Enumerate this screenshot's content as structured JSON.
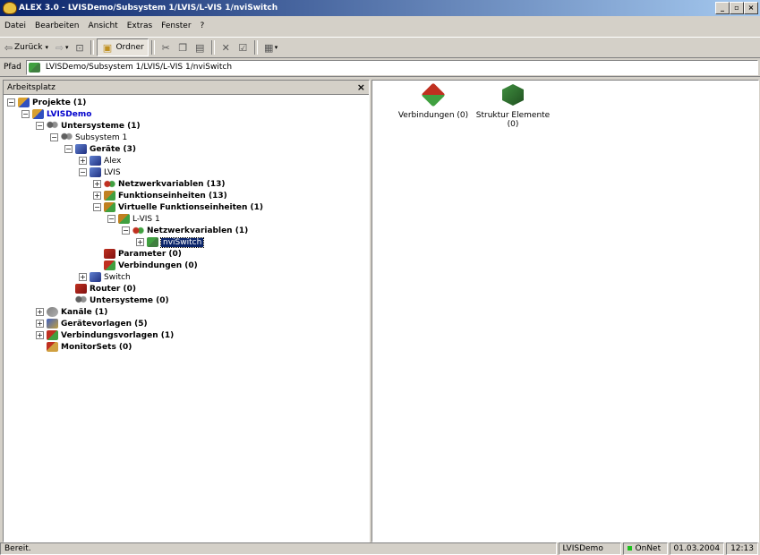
{
  "window": {
    "title": "ALEX 3.0 - LVISDemo/Subsystem 1/LVIS/L-VIS 1/nviSwitch"
  },
  "menu": [
    {
      "label": "Datei"
    },
    {
      "label": "Bearbeiten"
    },
    {
      "label": "Ansicht"
    },
    {
      "label": "Extras"
    },
    {
      "label": "Fenster"
    },
    {
      "label": "?"
    }
  ],
  "toolbar": {
    "back_label": "Zurück",
    "folder_label": "Ordner"
  },
  "address": {
    "label": "Pfad",
    "value": "LVISDemo/Subsystem 1/LVIS/L-VIS 1/nviSwitch"
  },
  "left_panel": {
    "title": "Arbeitsplatz",
    "close": "×"
  },
  "tree": [
    {
      "label": "Projekte (1)",
      "level": 0,
      "exp": "-",
      "icon": "cube",
      "bold": true
    },
    {
      "label": "LVISDemo",
      "level": 1,
      "exp": "-",
      "icon": "cube",
      "bold": true,
      "blue": true
    },
    {
      "label": "Untersysteme (1)",
      "level": 2,
      "exp": "-",
      "icon": "people",
      "bold": true
    },
    {
      "label": "Subsystem 1",
      "level": 3,
      "exp": "-",
      "icon": "people"
    },
    {
      "label": "Geräte (3)",
      "level": 4,
      "exp": "-",
      "icon": "dev",
      "bold": true
    },
    {
      "label": "Alex",
      "level": 5,
      "exp": "+",
      "icon": "dev"
    },
    {
      "label": "LVIS",
      "level": 5,
      "exp": "-",
      "icon": "dev"
    },
    {
      "label": "Netzwerkvariablen (13)",
      "level": 6,
      "exp": "+",
      "icon": "nv",
      "bold": true
    },
    {
      "label": "Funktionseinheiten (13)",
      "level": 6,
      "exp": "+",
      "icon": "func",
      "bold": true
    },
    {
      "label": "Virtuelle Funktionseinheiten (1)",
      "level": 6,
      "exp": "-",
      "icon": "func",
      "bold": true
    },
    {
      "label": "L-VIS 1",
      "level": 7,
      "exp": "-",
      "icon": "func"
    },
    {
      "label": "Netzwerkvariablen (1)",
      "level": 8,
      "exp": "-",
      "icon": "nv",
      "bold": true
    },
    {
      "label": "nviSwitch",
      "level": 9,
      "exp": "+",
      "icon": "nvi",
      "selected": true
    },
    {
      "label": "Parameter (0)",
      "level": 6,
      "exp": "",
      "icon": "param",
      "bold": true
    },
    {
      "label": "Verbindungen (0)",
      "level": 6,
      "exp": "",
      "icon": "conn",
      "bold": true
    },
    {
      "label": "Switch",
      "level": 5,
      "exp": "+",
      "icon": "dev"
    },
    {
      "label": "Router (0)",
      "level": 4,
      "exp": "",
      "icon": "param",
      "bold": true
    },
    {
      "label": "Untersysteme (0)",
      "level": 4,
      "exp": "",
      "icon": "people",
      "bold": true
    },
    {
      "label": "Kanäle (1)",
      "level": 2,
      "exp": "+",
      "icon": "chan",
      "bold": true
    },
    {
      "label": "Gerätevorlagen (5)",
      "level": 2,
      "exp": "+",
      "icon": "tpl",
      "bold": true
    },
    {
      "label": "Verbindungsvorlagen (1)",
      "level": 2,
      "exp": "+",
      "icon": "conn",
      "bold": true
    },
    {
      "label": "MonitorSets (0)",
      "level": 2,
      "exp": "",
      "icon": "mon",
      "bold": true
    }
  ],
  "content_items": [
    {
      "label": "Verbindungen (0)",
      "icon": "connections-icon"
    },
    {
      "label": "Struktur Elemente (0)",
      "icon": "structure-elements-icon"
    }
  ],
  "status": {
    "text": "Bereit.",
    "project": "LVISDemo",
    "net": "OnNet",
    "date": "01.03.2004",
    "time": "12:13"
  }
}
